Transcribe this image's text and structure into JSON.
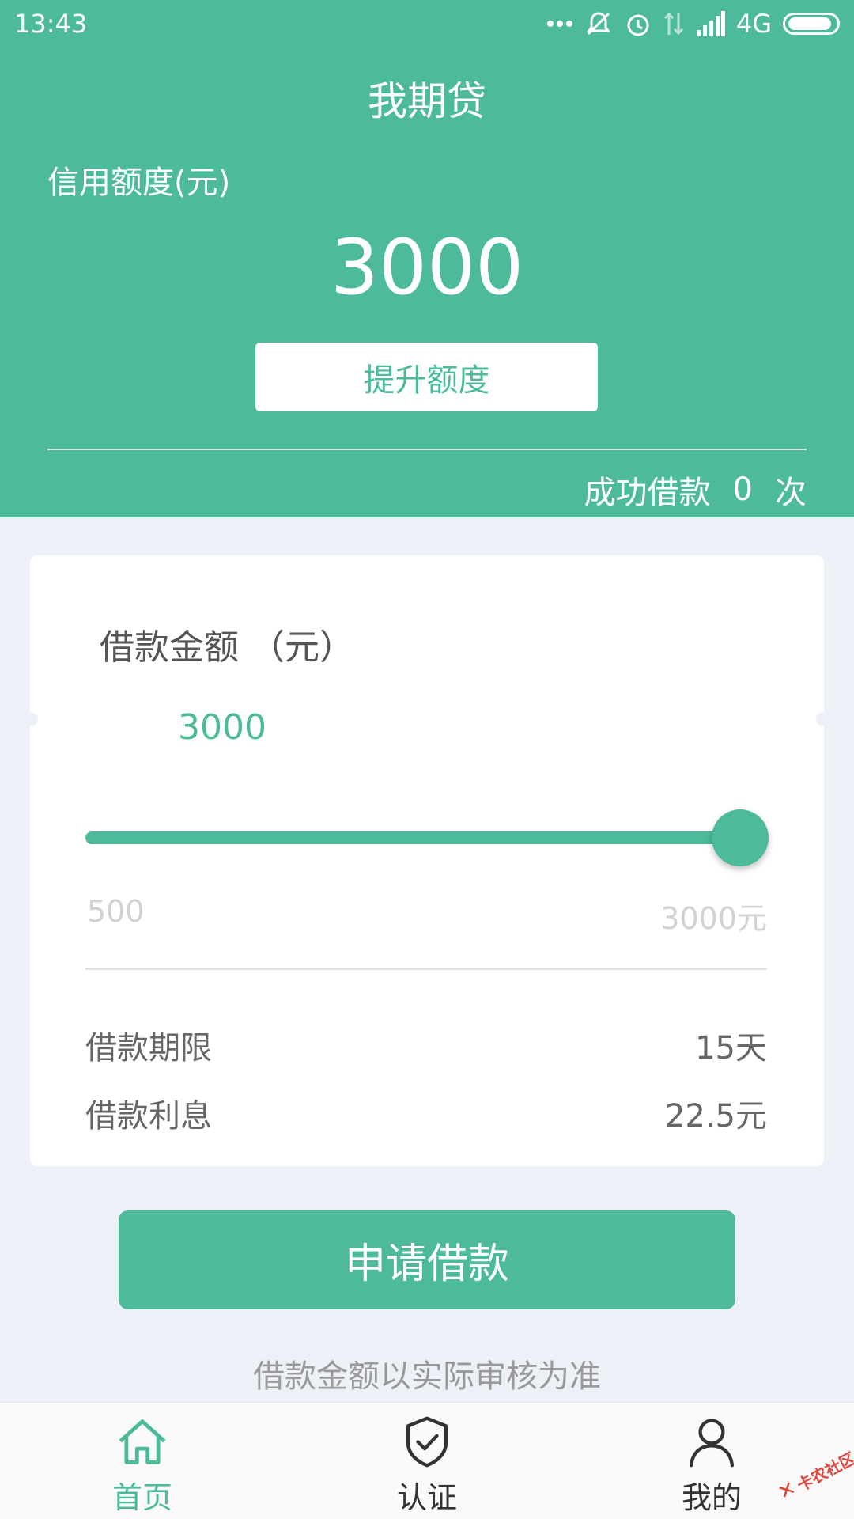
{
  "status_bar": {
    "time": "13:43",
    "network": "4G",
    "icons": [
      "dots-icon",
      "mute-icon",
      "alarm-icon",
      "data-icon",
      "signal-icon",
      "battery-icon"
    ]
  },
  "header": {
    "title": "我期贷",
    "credit_label": "信用额度(元)",
    "credit_value": "3000",
    "raise_button": "提升额度",
    "success_prefix": "成功借款",
    "success_count": "0",
    "success_suffix": "次"
  },
  "loan_card": {
    "title": "借款金额 （元）",
    "amount": "3000",
    "slider": {
      "min": 500,
      "max": 3000,
      "value": 3000
    },
    "min_label": "500",
    "max_label": "3000元",
    "term_label": "借款期限",
    "term_value": "15天",
    "interest_label": "借款利息",
    "interest_value": "22.5元"
  },
  "apply_button": "申请借款",
  "note": "借款金额以实际审核为准",
  "tabs": [
    {
      "label": "首页",
      "icon": "home-icon",
      "active": true
    },
    {
      "label": "认证",
      "icon": "shield-check-icon",
      "active": false
    },
    {
      "label": "我的",
      "icon": "user-icon",
      "active": false
    }
  ],
  "watermark": {
    "text": "卡农社区"
  },
  "colors": {
    "primary": "#4dbb9b",
    "background": "#edf0f6"
  }
}
